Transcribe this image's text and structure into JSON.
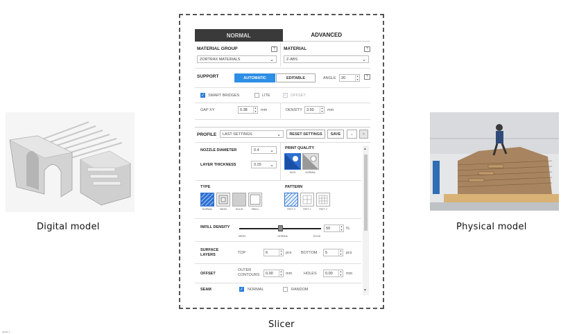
{
  "captions": {
    "digital": "Digital model",
    "physical": "Physical model",
    "slicer": "Slicer"
  },
  "corner_note": "planter 1",
  "tabs": {
    "normal": "NORMAL",
    "advanced": "ADVANCED"
  },
  "material": {
    "group_label": "MATERIAL GROUP",
    "group_value": "ZORTRAX MATERIALS",
    "material_label": "MATERIAL",
    "material_value": "Z-ABS",
    "help": "?"
  },
  "support": {
    "label": "SUPPORT",
    "automatic": "AUTOMATIC",
    "editable": "EDITABLE",
    "angle_label": "ANGLE",
    "angle_value": "20",
    "smart_bridges": "SMART BRIDGES",
    "lite": "LITE",
    "offset": "OFFSET",
    "gap_label": "GAP XY",
    "gap_value": "0.38",
    "gap_unit": "mm",
    "density_label": "DENSITY",
    "density_value": "3.50",
    "density_unit": "mm"
  },
  "profile": {
    "label": "PROFILE",
    "value": "LAST SETTINGS",
    "reset": "RESET SETTINGS",
    "save": "SAVE",
    "back": "←",
    "close": "×"
  },
  "nozzle": {
    "label": "NOZZLE DIAMETER",
    "value": "0.4"
  },
  "layer": {
    "label": "LAYER THICKNESS",
    "value": "0.29"
  },
  "quality": {
    "label": "PRINT QUALITY",
    "high": "HIGH",
    "normal": "NORMAL"
  },
  "type": {
    "label": "TYPE",
    "items": [
      "NORMAL",
      "MESH",
      "SOLID",
      "SHELL"
    ]
  },
  "pattern": {
    "label": "PATTERN",
    "items": [
      "PATT 0",
      "PATT 1",
      "PATT 2"
    ]
  },
  "infill": {
    "label": "INFILL DENSITY",
    "value": "50",
    "unit": "%",
    "level": 0.5,
    "ticks": [
      "MESH",
      "NORMAL",
      "SOLID"
    ]
  },
  "surface": {
    "label1": "SURFACE",
    "label2": "LAYERS",
    "top_label": "TOP",
    "top_value": "6",
    "top_unit": "pcs",
    "bottom_label": "BOTTOM",
    "bottom_value": "5",
    "bottom_unit": "pcs"
  },
  "offset_row": {
    "label": "OFFSET",
    "outer1": "OUTER",
    "outer2": "CONTOURS",
    "outer_value": "0.00",
    "outer_unit": "mm",
    "holes_label": "HOLES",
    "holes_value": "0.00",
    "holes_unit": "mm"
  },
  "seam": {
    "label": "SEAM",
    "normal": "NORMAL",
    "random": "RANDOM"
  },
  "colors": {
    "accent": "#2d8ee6",
    "tab_dark": "#3a3a3a"
  }
}
